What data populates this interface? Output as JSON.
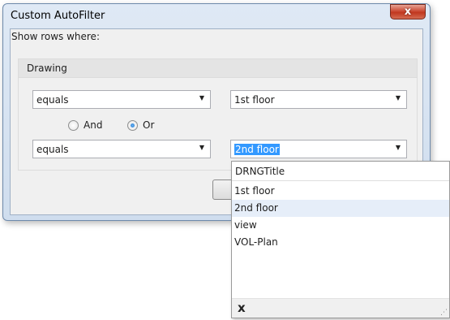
{
  "window": {
    "title": "Custom AutoFilter",
    "close_glyph": "x"
  },
  "filter": {
    "prompt": "Show rows where:",
    "column_name": "Drawing",
    "row1": {
      "operator": "equals",
      "value": "1st floor"
    },
    "logic": {
      "and_label": "And",
      "or_label": "Or",
      "selected": "Or"
    },
    "row2": {
      "operator": "equals",
      "value": "2nd floor"
    }
  },
  "dropdown": {
    "header": "DRNGTitle",
    "items": [
      "1st floor",
      "2nd floor",
      "view",
      "VOL-Plan"
    ],
    "selected": "2nd floor",
    "clear_glyph": "x"
  },
  "icons": {
    "arrow": "chevron-down-icon",
    "close": "close-icon",
    "clear": "clear-icon",
    "grip": "resize-grip-icon"
  },
  "colors": {
    "selection": "#3399ff",
    "list_hover": "#e6eef9",
    "close_button": "#c0371f"
  }
}
